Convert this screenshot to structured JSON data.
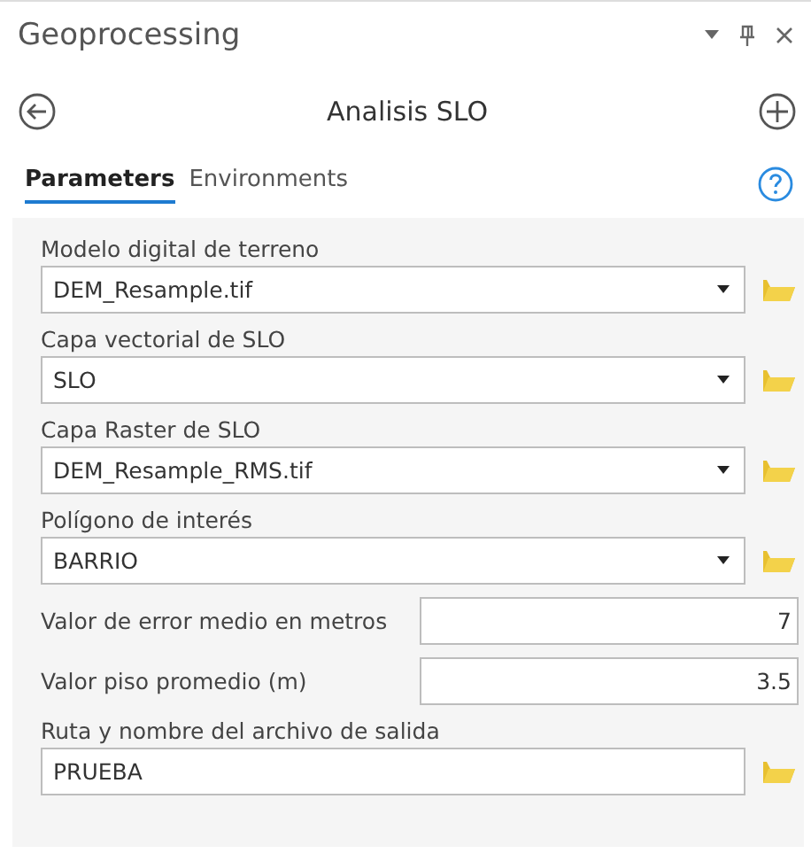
{
  "window": {
    "title": "Geoprocessing"
  },
  "tool": {
    "title": "Analisis SLO"
  },
  "tabs": [
    {
      "label": "Parameters",
      "selected": true
    },
    {
      "label": "Environments",
      "selected": false
    }
  ],
  "parameters": [
    {
      "kind": "combo",
      "label": "Modelo digital de terreno",
      "value": "DEM_Resample.tif"
    },
    {
      "kind": "combo",
      "label": "Capa vectorial de SLO",
      "value": "SLO"
    },
    {
      "kind": "combo",
      "label": "Capa Raster de SLO",
      "value": "DEM_Resample_RMS.tif"
    },
    {
      "kind": "combo",
      "label": "Polígono de interés",
      "value": "BARRIO"
    },
    {
      "kind": "number",
      "label": "Valor de error medio en metros",
      "value": "7"
    },
    {
      "kind": "number",
      "label": "Valor piso promedio (m)",
      "value": "3.5"
    },
    {
      "kind": "file",
      "label": "Ruta y nombre del archivo de salida",
      "value": "PRUEBA"
    }
  ]
}
